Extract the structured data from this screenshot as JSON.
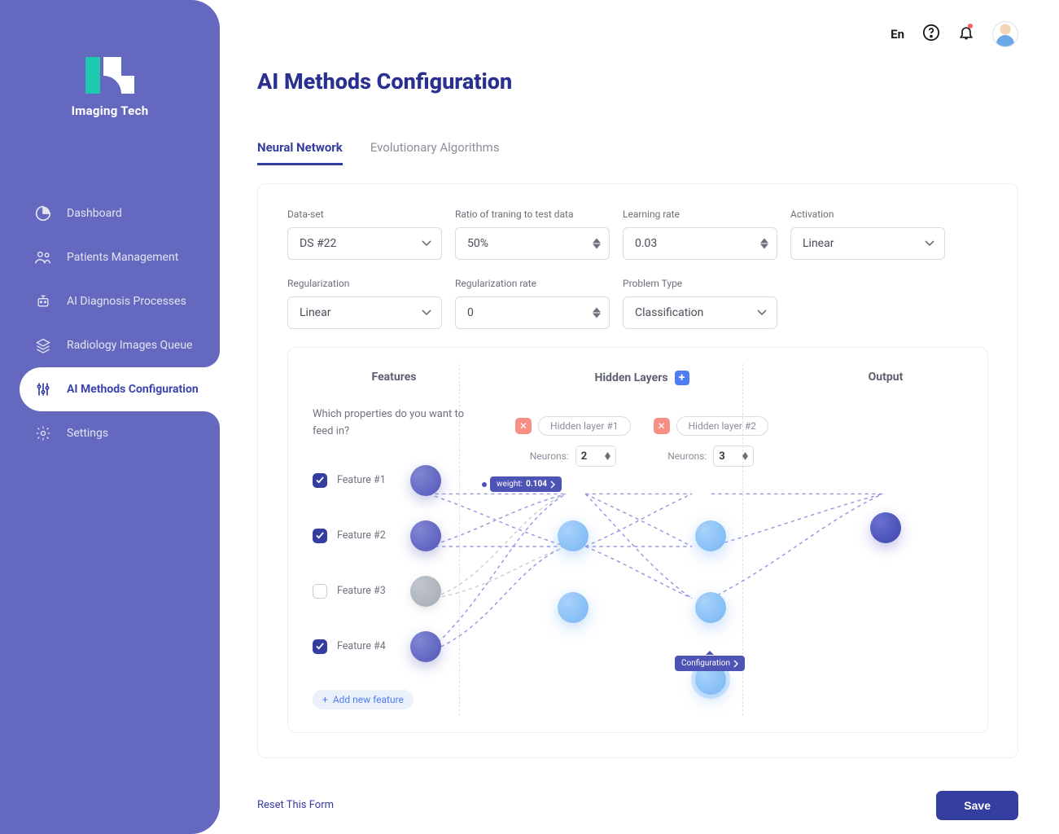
{
  "brand": "Imaging Tech",
  "header": {
    "language": "En"
  },
  "sidebar": {
    "items": [
      {
        "label": "Dashboard"
      },
      {
        "label": "Patients Management"
      },
      {
        "label": "AI Diagnosis Processes"
      },
      {
        "label": "Radiology Images Queue"
      },
      {
        "label": "AI Methods Configuration"
      },
      {
        "label": "Settings"
      }
    ],
    "activeIndex": 4
  },
  "page": {
    "title": "AI Methods Configuration"
  },
  "tabs": {
    "items": [
      "Neural Network",
      "Evolutionary Algorithms"
    ],
    "activeIndex": 0
  },
  "form": {
    "dataset": {
      "label": "Data-set",
      "value": "DS #22"
    },
    "ratio": {
      "label": "Ratio of traning to test data",
      "value": "50%"
    },
    "lr": {
      "label": "Learning rate",
      "value": "0.03"
    },
    "activation": {
      "label": "Activation",
      "value": "Linear"
    },
    "regularization": {
      "label": "Regularization",
      "value": "Linear"
    },
    "regrate": {
      "label": "Regularization rate",
      "value": "0"
    },
    "problem": {
      "label": "Problem Type",
      "value": "Classification"
    }
  },
  "nn": {
    "featuresTitle": "Features",
    "hiddenTitle": "Hidden Layers",
    "outputTitle": "Output",
    "question": "Which properties do you want to feed in?",
    "features": [
      {
        "label": "Feature #1",
        "checked": true,
        "disabled": false
      },
      {
        "label": "Feature #2",
        "checked": true,
        "disabled": false
      },
      {
        "label": "Feature #3",
        "checked": false,
        "disabled": false
      },
      {
        "label": "Feature #4",
        "checked": true,
        "disabled": false
      }
    ],
    "addFeature": "Add new feature",
    "hiddenLayers": [
      {
        "name": "Hidden layer #1",
        "neurons": "2"
      },
      {
        "name": "Hidden layer #2",
        "neurons": "3"
      }
    ],
    "neuronsLabel": "Neurons:",
    "weightTip": {
      "label": "weight:",
      "value": "0.104"
    },
    "configTip": "Configuration"
  },
  "footer": {
    "reset": "Reset This Form",
    "save": "Save"
  }
}
